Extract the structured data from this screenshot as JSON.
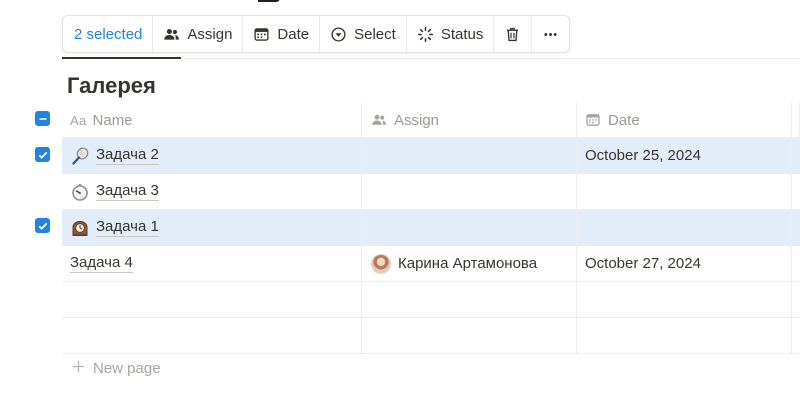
{
  "toolbar": {
    "selected_label": "2 selected",
    "assign_label": "Assign",
    "date_label": "Date",
    "select_label": "Select",
    "status_label": "Status"
  },
  "view": {
    "title": "Галерея"
  },
  "columns": {
    "name_prefix": "Aa",
    "name": "Name",
    "assign": "Assign",
    "date": "Date"
  },
  "rows": [
    {
      "name": "Задача 2",
      "emoji": "tennis-racket-icon",
      "assign": "",
      "date": "October 25, 2024",
      "selected": true
    },
    {
      "name": "Задача 3",
      "emoji": "stopwatch-icon",
      "assign": "",
      "date": "",
      "selected": false
    },
    {
      "name": "Задача 1",
      "emoji": "mantelpiece-clock-icon",
      "assign": "",
      "date": "",
      "selected": true
    },
    {
      "name": "Задача 4",
      "emoji": "",
      "assign": "Карина Артамонова",
      "date": "October 27, 2024",
      "selected": false
    }
  ],
  "new_page_label": "New page",
  "colors": {
    "accent": "#2383e2",
    "selected_row": "#e2edf9",
    "text": "#37352f",
    "muted": "#9b9a97"
  }
}
